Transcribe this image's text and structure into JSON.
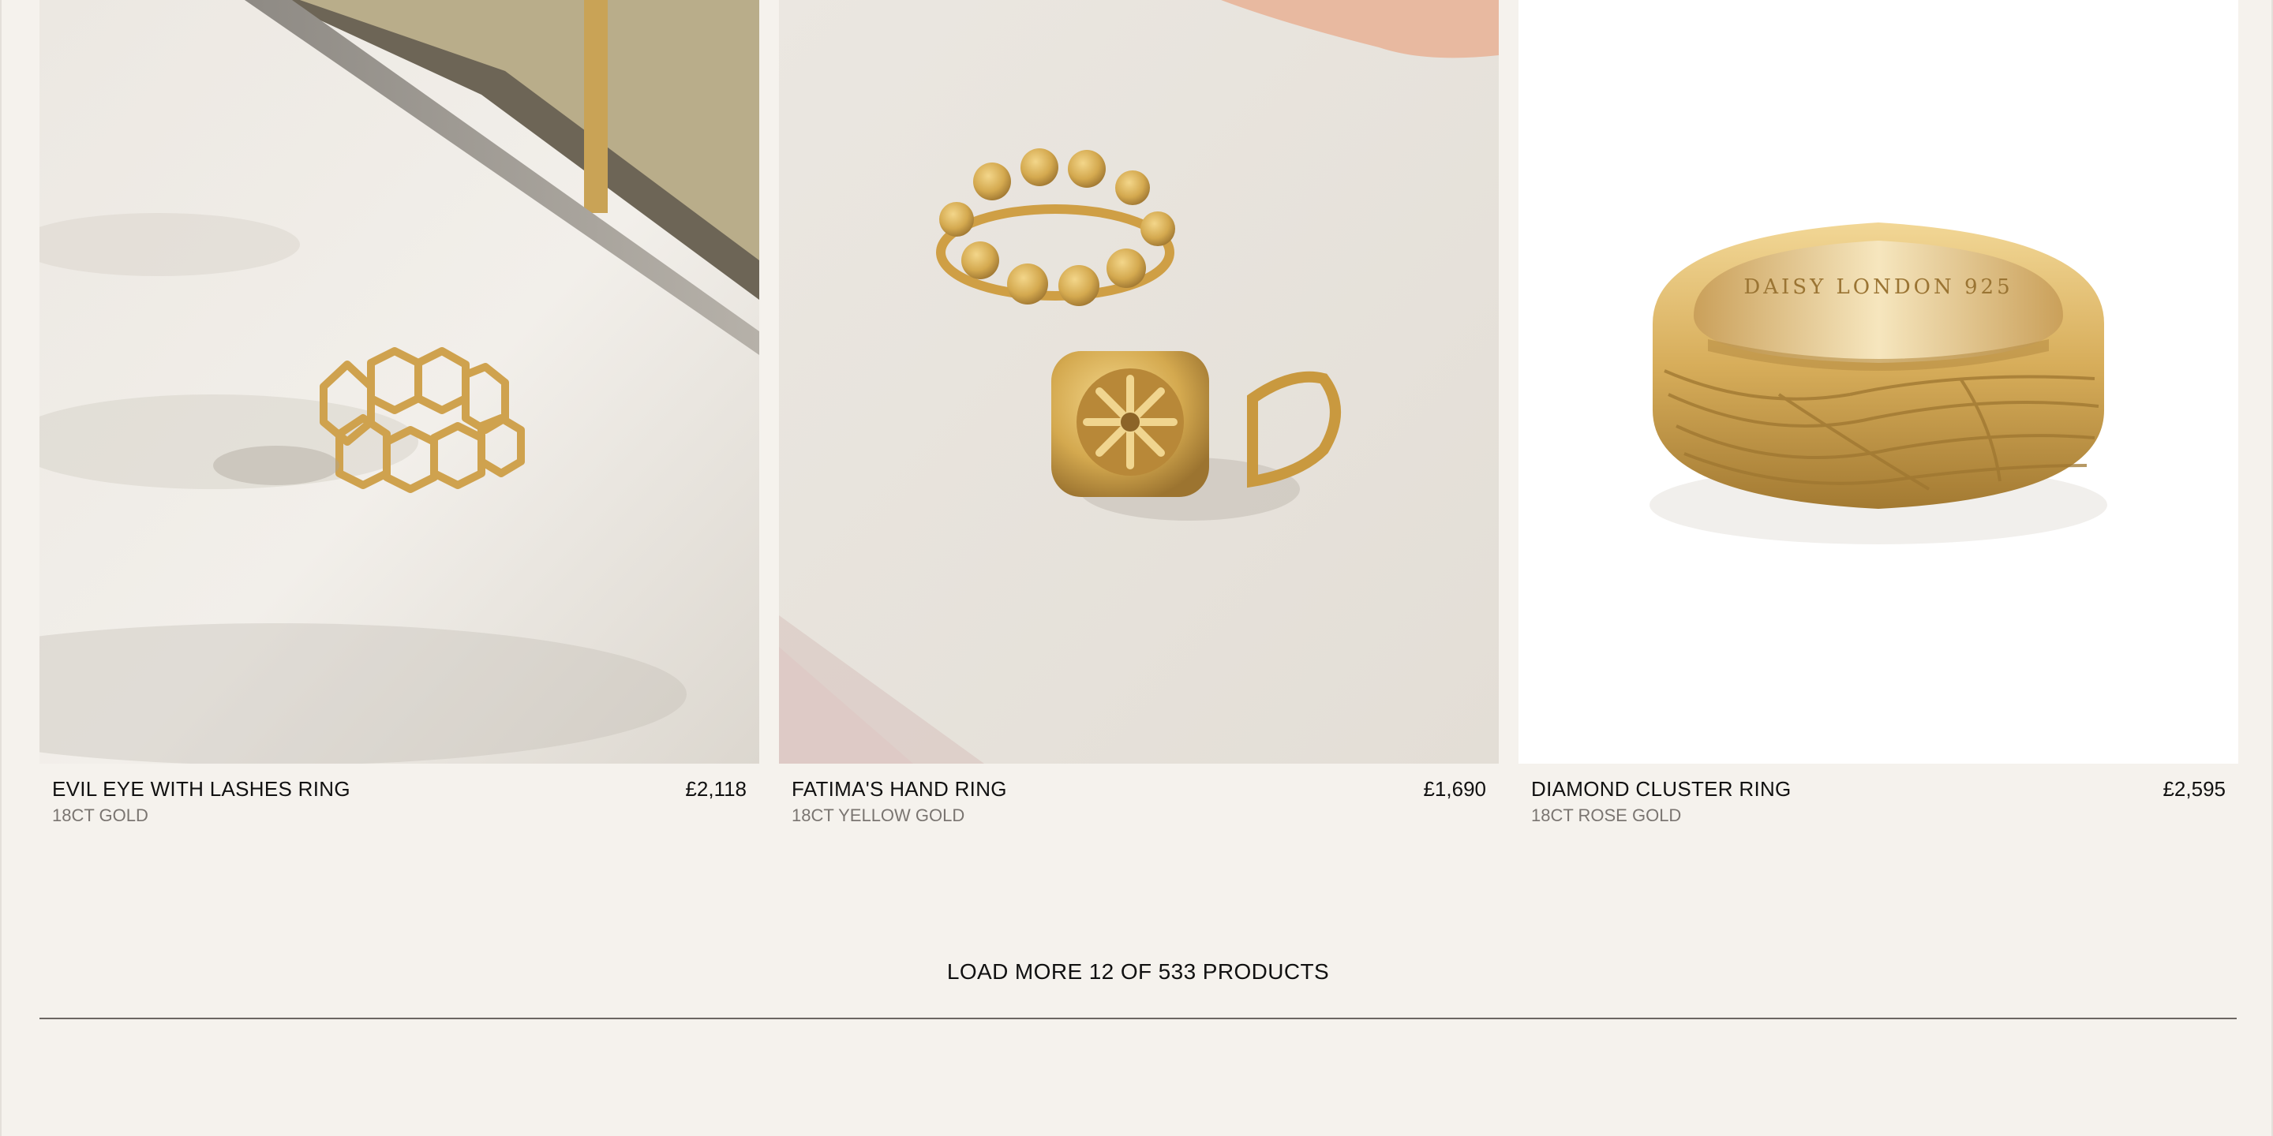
{
  "products": [
    {
      "name": "EVIL EYE WITH LASHES RING",
      "material": "18CT GOLD",
      "price": "£2,118",
      "image_icon": "honeycomb-ring-photo"
    },
    {
      "name": "FATIMA'S HAND RING",
      "material": "18CT YELLOW GOLD",
      "price": "£1,690",
      "image_icon": "signet-ring-photo"
    },
    {
      "name": "DIAMOND CLUSTER RING",
      "material": "18CT ROSE GOLD",
      "price": "£2,595",
      "image_icon": "textured-band-ring-photo",
      "engraving": "DAISY LONDON 925"
    }
  ],
  "load_more": {
    "label": "LOAD MORE 12 OF 533 PRODUCTS"
  },
  "colors": {
    "page_background": "#f5f2ed",
    "gold": "#d4a94f",
    "text": "#111111",
    "muted_text": "#7a7571"
  }
}
